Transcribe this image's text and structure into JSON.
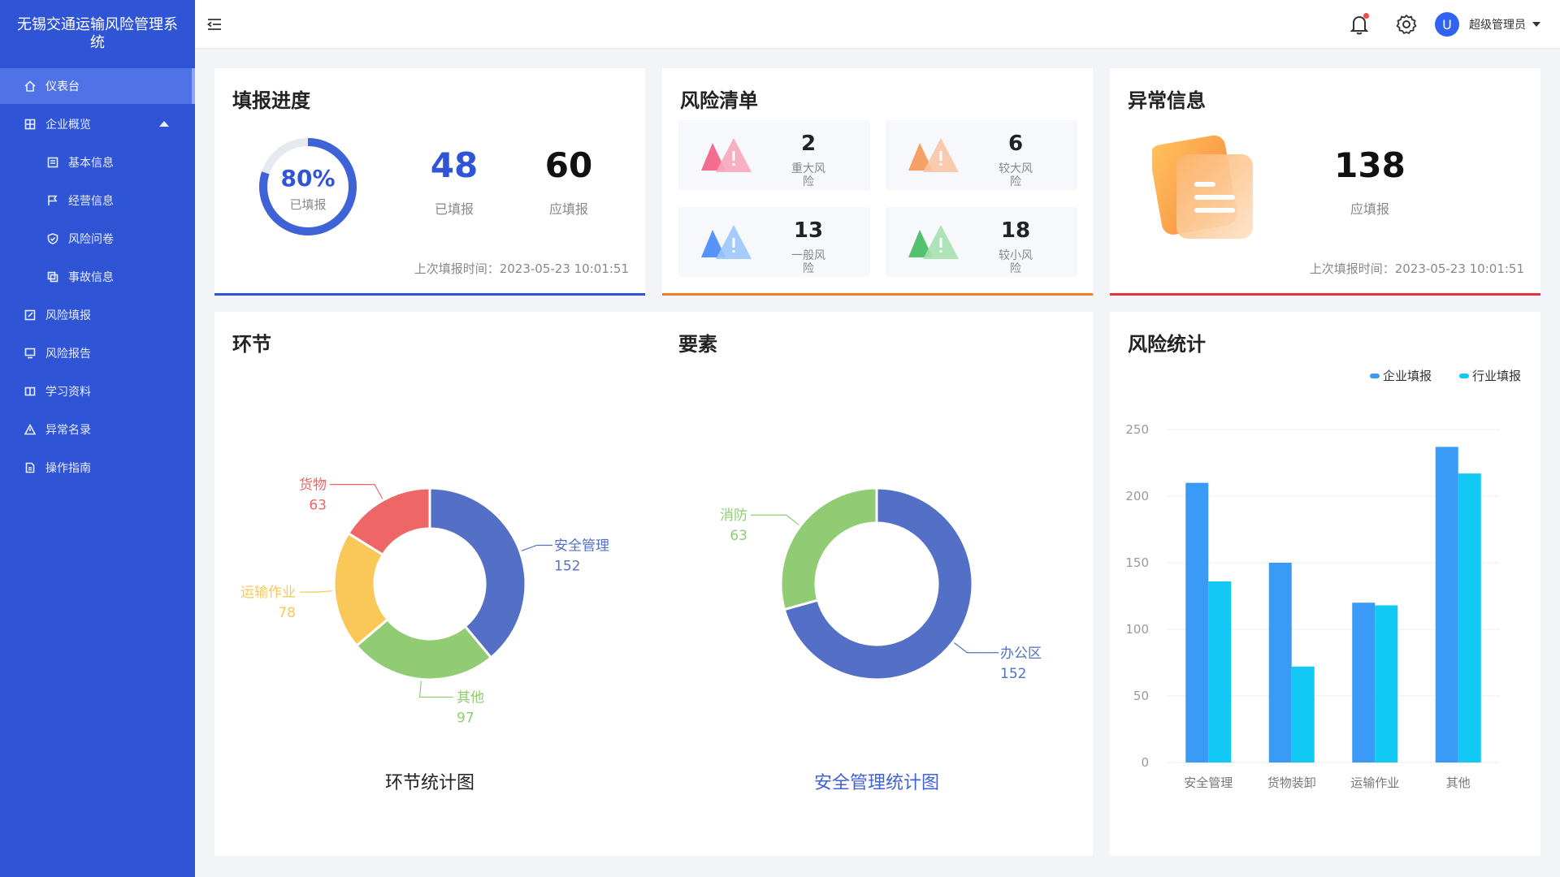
{
  "app": {
    "title": "无锡交通运输风险管理系统"
  },
  "sidebar": {
    "items": [
      {
        "label": "仪表台",
        "icon": "home-icon"
      },
      {
        "label": "企业概览",
        "icon": "grid-icon"
      },
      {
        "label": "基本信息",
        "icon": "info-icon"
      },
      {
        "label": "经营信息",
        "icon": "flag-icon"
      },
      {
        "label": "风险问卷",
        "icon": "shield-icon"
      },
      {
        "label": "事故信息",
        "icon": "copy-icon"
      },
      {
        "label": "风险填报",
        "icon": "edit-icon"
      },
      {
        "label": "风险报告",
        "icon": "monitor-icon"
      },
      {
        "label": "学习资料",
        "icon": "book-icon"
      },
      {
        "label": "异常名录",
        "icon": "warning-icon"
      },
      {
        "label": "操作指南",
        "icon": "file-icon"
      }
    ]
  },
  "header": {
    "user": {
      "avatar_letter": "U",
      "name": "超级管理员"
    }
  },
  "progress": {
    "title": "填报进度",
    "percent_label": "80%",
    "percent_value": 0.8,
    "ring_label": "已填报",
    "filled": "48",
    "filled_label": "已填报",
    "required": "60",
    "required_label": "应填报",
    "last_time": "上次填报时间：2023-05-23 10:01:51",
    "accent": "#2f54d6"
  },
  "risk_list": {
    "title": "风险清单",
    "accent": "#f07b2a",
    "tiles": [
      {
        "count": "2",
        "label": "重大风险",
        "color": "#f2557b"
      },
      {
        "count": "6",
        "label": "较大风险",
        "color": "#f6904c"
      },
      {
        "count": "13",
        "label": "一般风险",
        "color": "#3b82f6"
      },
      {
        "count": "18",
        "label": "较小风险",
        "color": "#35b856"
      }
    ]
  },
  "anomaly": {
    "title": "异常信息",
    "count": "138",
    "count_label": "应填报",
    "last_time": "上次填报时间：2023-05-23 10:01:51",
    "accent": "#e53340"
  },
  "stage": {
    "title": "环节",
    "caption": "环节统计图"
  },
  "element": {
    "title": "要素",
    "caption": "安全管理统计图"
  },
  "risk_stats": {
    "title": "风险统计"
  },
  "chart_data": [
    {
      "type": "pie",
      "variant": "donut",
      "title": "环节统计图",
      "slices": [
        {
          "label": "安全管理",
          "value": 152,
          "color": "#5470c6"
        },
        {
          "label": "其他",
          "value": 97,
          "color": "#91cc75"
        },
        {
          "label": "运输作业",
          "value": 78,
          "color": "#fac858"
        },
        {
          "label": "货物",
          "value": 63,
          "color": "#ee6666"
        }
      ]
    },
    {
      "type": "pie",
      "variant": "donut",
      "title": "安全管理统计图",
      "slices": [
        {
          "label": "办公区",
          "value": 152,
          "color": "#5470c6"
        },
        {
          "label": "消防",
          "value": 63,
          "color": "#91cc75"
        }
      ]
    },
    {
      "type": "bar",
      "title": "风险统计",
      "categories": [
        "安全管理",
        "货物装卸",
        "运输作业",
        "其他"
      ],
      "series": [
        {
          "name": "企业填报",
          "values": [
            210,
            150,
            120,
            237
          ],
          "color": "#3a9bf7"
        },
        {
          "name": "行业填报",
          "values": [
            136,
            72,
            118,
            217
          ],
          "color": "#12c8f5"
        }
      ],
      "ylim": [
        0,
        250
      ],
      "yticks": [
        0,
        50,
        100,
        150,
        200,
        250
      ],
      "grid": true,
      "legend": "top-right"
    }
  ]
}
